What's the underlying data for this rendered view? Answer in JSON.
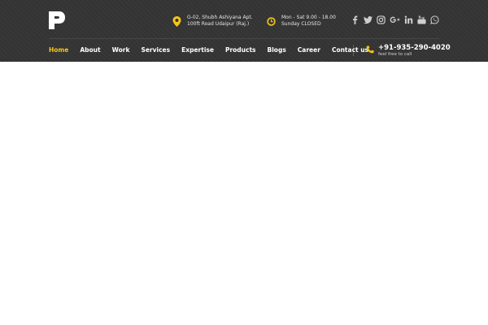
{
  "brand": {
    "logo_icon": "p-letter-logo"
  },
  "contact_info": {
    "address": {
      "icon": "map-pin-icon",
      "line1": "G-02, Shubh Ashiyana Apt.",
      "line2": "100ft Road Udaipur (Raj.)"
    },
    "hours": {
      "icon": "clock-icon",
      "line1": "Mon - Sat 9.00 - 18.00",
      "line2": "Sunday CLOSED"
    }
  },
  "social": [
    "facebook-icon",
    "twitter-icon",
    "instagram-icon",
    "google-plus-icon",
    "linkedin-icon",
    "youtube-icon",
    "whatsapp-icon"
  ],
  "nav": {
    "items": [
      {
        "label": "Home",
        "active": true
      },
      {
        "label": "About"
      },
      {
        "label": "Work"
      },
      {
        "label": "Services"
      },
      {
        "label": "Expertise"
      },
      {
        "label": "Products"
      },
      {
        "label": "Blogs"
      },
      {
        "label": "Career"
      },
      {
        "label": "Contact us"
      }
    ]
  },
  "call": {
    "icon": "phone-icon",
    "number": "+91-935-290-4020",
    "subtitle": "feel free to call"
  },
  "colors": {
    "header_bg": "#333333",
    "accent": "#f5c518",
    "text": "#ffffff",
    "page_bg": "#ffffff"
  }
}
